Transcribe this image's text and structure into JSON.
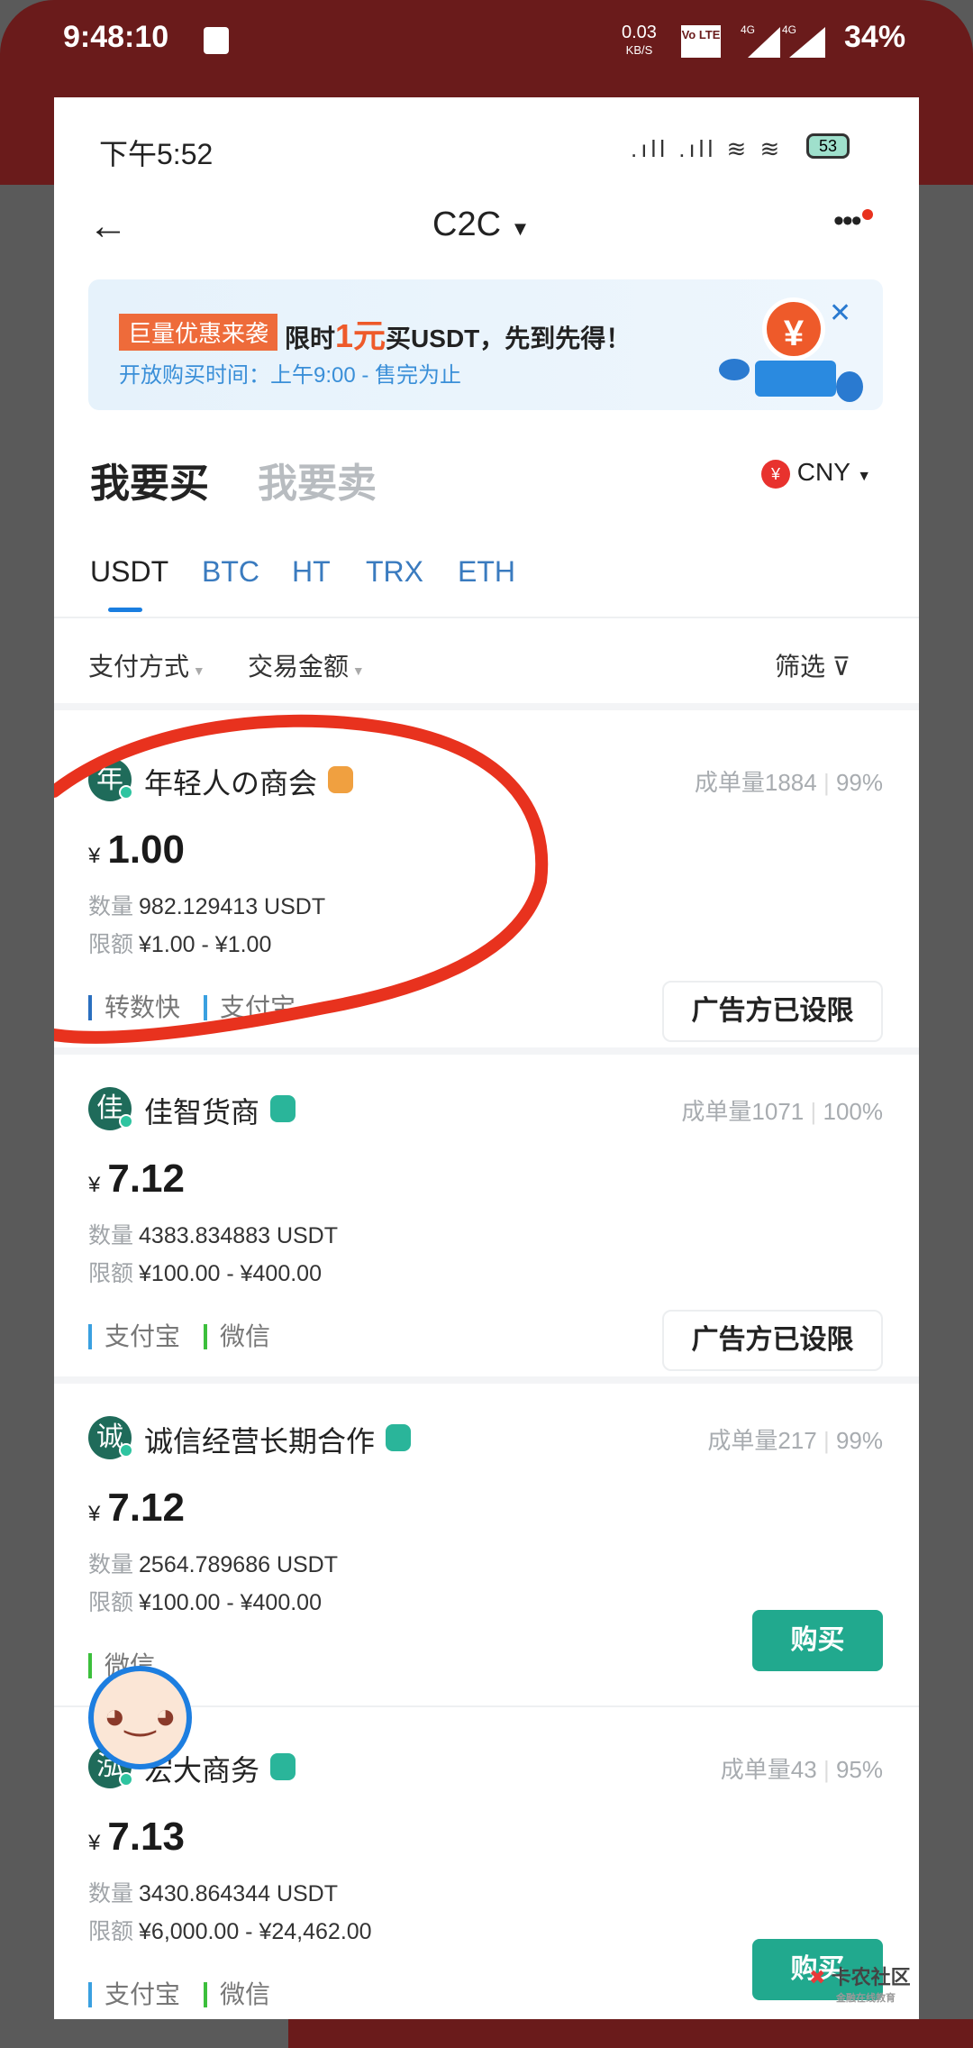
{
  "outer_status": {
    "time": "9:48:10",
    "speed": "0.03",
    "speed_unit": "KB/S",
    "volte": "Vo LTE",
    "net1": "4G",
    "net2": "4G",
    "battery": "34%"
  },
  "inner_status": {
    "time": "下午5:52",
    "battery": "53"
  },
  "header": {
    "title": "C2C"
  },
  "banner": {
    "tag": "巨量优惠来袭",
    "headline_pre": "限时",
    "headline_highlight": "1元",
    "headline_post": "买USDT，先到先得！",
    "subtitle": "开放购买时间：上午9:00 - 售完为止"
  },
  "mode_tabs": [
    {
      "label": "我要买",
      "active": true
    },
    {
      "label": "我要卖",
      "active": false
    }
  ],
  "currency": "CNY",
  "coins": [
    {
      "label": "USDT",
      "active": true
    },
    {
      "label": "BTC"
    },
    {
      "label": "HT"
    },
    {
      "label": "TRX"
    },
    {
      "label": "ETH"
    }
  ],
  "filters": {
    "payment": "支付方式",
    "amount": "交易金额",
    "filter": "筛选"
  },
  "labels": {
    "qty": "数量",
    "limit": "限额",
    "orders": "成单量",
    "yen": "¥"
  },
  "listings": [
    {
      "avatar": "年",
      "name": "年轻人の商会",
      "badge": "crown",
      "orders": "1884",
      "rate": "99%",
      "price": "1.00",
      "qty": "982.129413 USDT",
      "limit": "¥1.00 - ¥1.00",
      "button": "广告方已设限",
      "tags": [
        "转数快",
        "支付宝"
      ]
    },
    {
      "avatar": "佳",
      "name": "佳智货商",
      "badge": "verified",
      "orders": "1071",
      "rate": "100%",
      "price": "7.12",
      "qty": "4383.834883 USDT",
      "limit": "¥100.00 - ¥400.00",
      "button": "广告方已设限",
      "tags": [
        "支付宝",
        "微信"
      ]
    },
    {
      "avatar": "诚",
      "name": "诚信经营长期合作",
      "badge": "verified",
      "orders": "217",
      "rate": "99%",
      "price": "7.12",
      "qty": "2564.789686 USDT",
      "limit": "¥100.00 - ¥400.00",
      "button": "购买",
      "tags": [
        "微信"
      ]
    },
    {
      "avatar": "泓",
      "name": "宏大商务",
      "badge": "verified",
      "orders": "43",
      "rate": "95%",
      "price": "7.13",
      "qty": "3430.864344 USDT",
      "limit": "¥6,000.00 - ¥24,462.00",
      "button": "购买",
      "tags": [
        "支付宝",
        "微信"
      ]
    }
  ],
  "watermark": {
    "name": "卡农社区",
    "sub": "金融在线教育"
  },
  "colors": {
    "accent": "#21a98e",
    "annotation": "#e8321e",
    "outer_bar": "#6a1b1b"
  }
}
